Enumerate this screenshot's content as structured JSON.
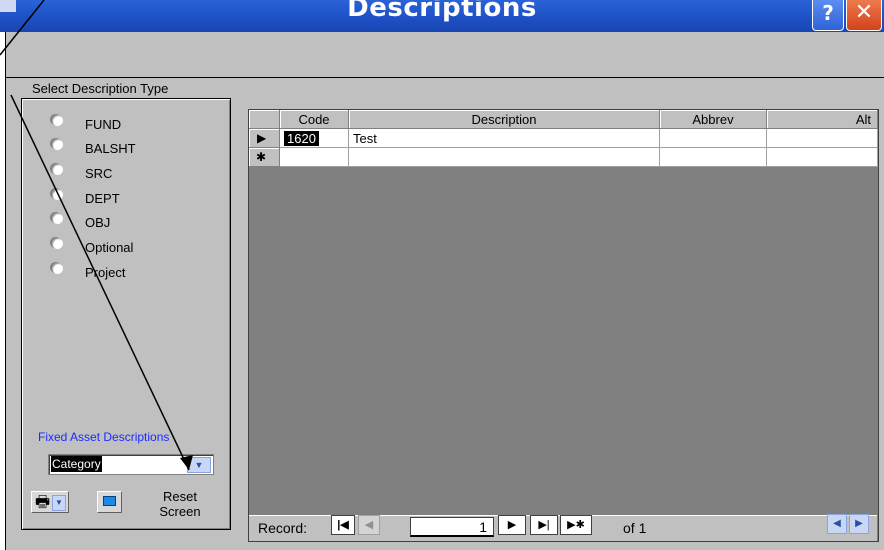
{
  "window": {
    "title": "Descriptions",
    "help_label": "?",
    "close_label": "✕"
  },
  "left_panel": {
    "title": "Select Description Type",
    "options": [
      {
        "label": "FUND"
      },
      {
        "label": "BALSHT"
      },
      {
        "label": "SRC"
      },
      {
        "label": "DEPT"
      },
      {
        "label": "OBJ"
      },
      {
        "label": "Optional"
      },
      {
        "label": "Project"
      }
    ],
    "fixed_asset_label": "Fixed Asset Descriptions",
    "category_value": "Category",
    "reset_label_line1": "Reset",
    "reset_label_line2": "Screen"
  },
  "grid": {
    "columns": [
      "Code",
      "Description",
      "Abbrev",
      "Alt"
    ],
    "rows": [
      {
        "selector": "▶",
        "code": "1620",
        "description": "Test",
        "abbrev": "",
        "alt": ""
      },
      {
        "selector": "✱",
        "code": "",
        "description": "",
        "abbrev": "",
        "alt": ""
      }
    ]
  },
  "navigation": {
    "record_label": "Record:",
    "current_record": "1",
    "of_label": "of 1"
  },
  "icons": {
    "first": "first-record-icon",
    "prev": "prev-record-icon",
    "next": "next-record-icon",
    "last": "last-record-icon",
    "new": "new-record-icon",
    "print": "printer-icon",
    "screen": "screen-icon"
  },
  "colors": {
    "titlebar": "#1d4fc4",
    "form_bg": "#c0c0c0",
    "datasheet_bg": "#808080",
    "accent_text": "#1a2bff"
  }
}
